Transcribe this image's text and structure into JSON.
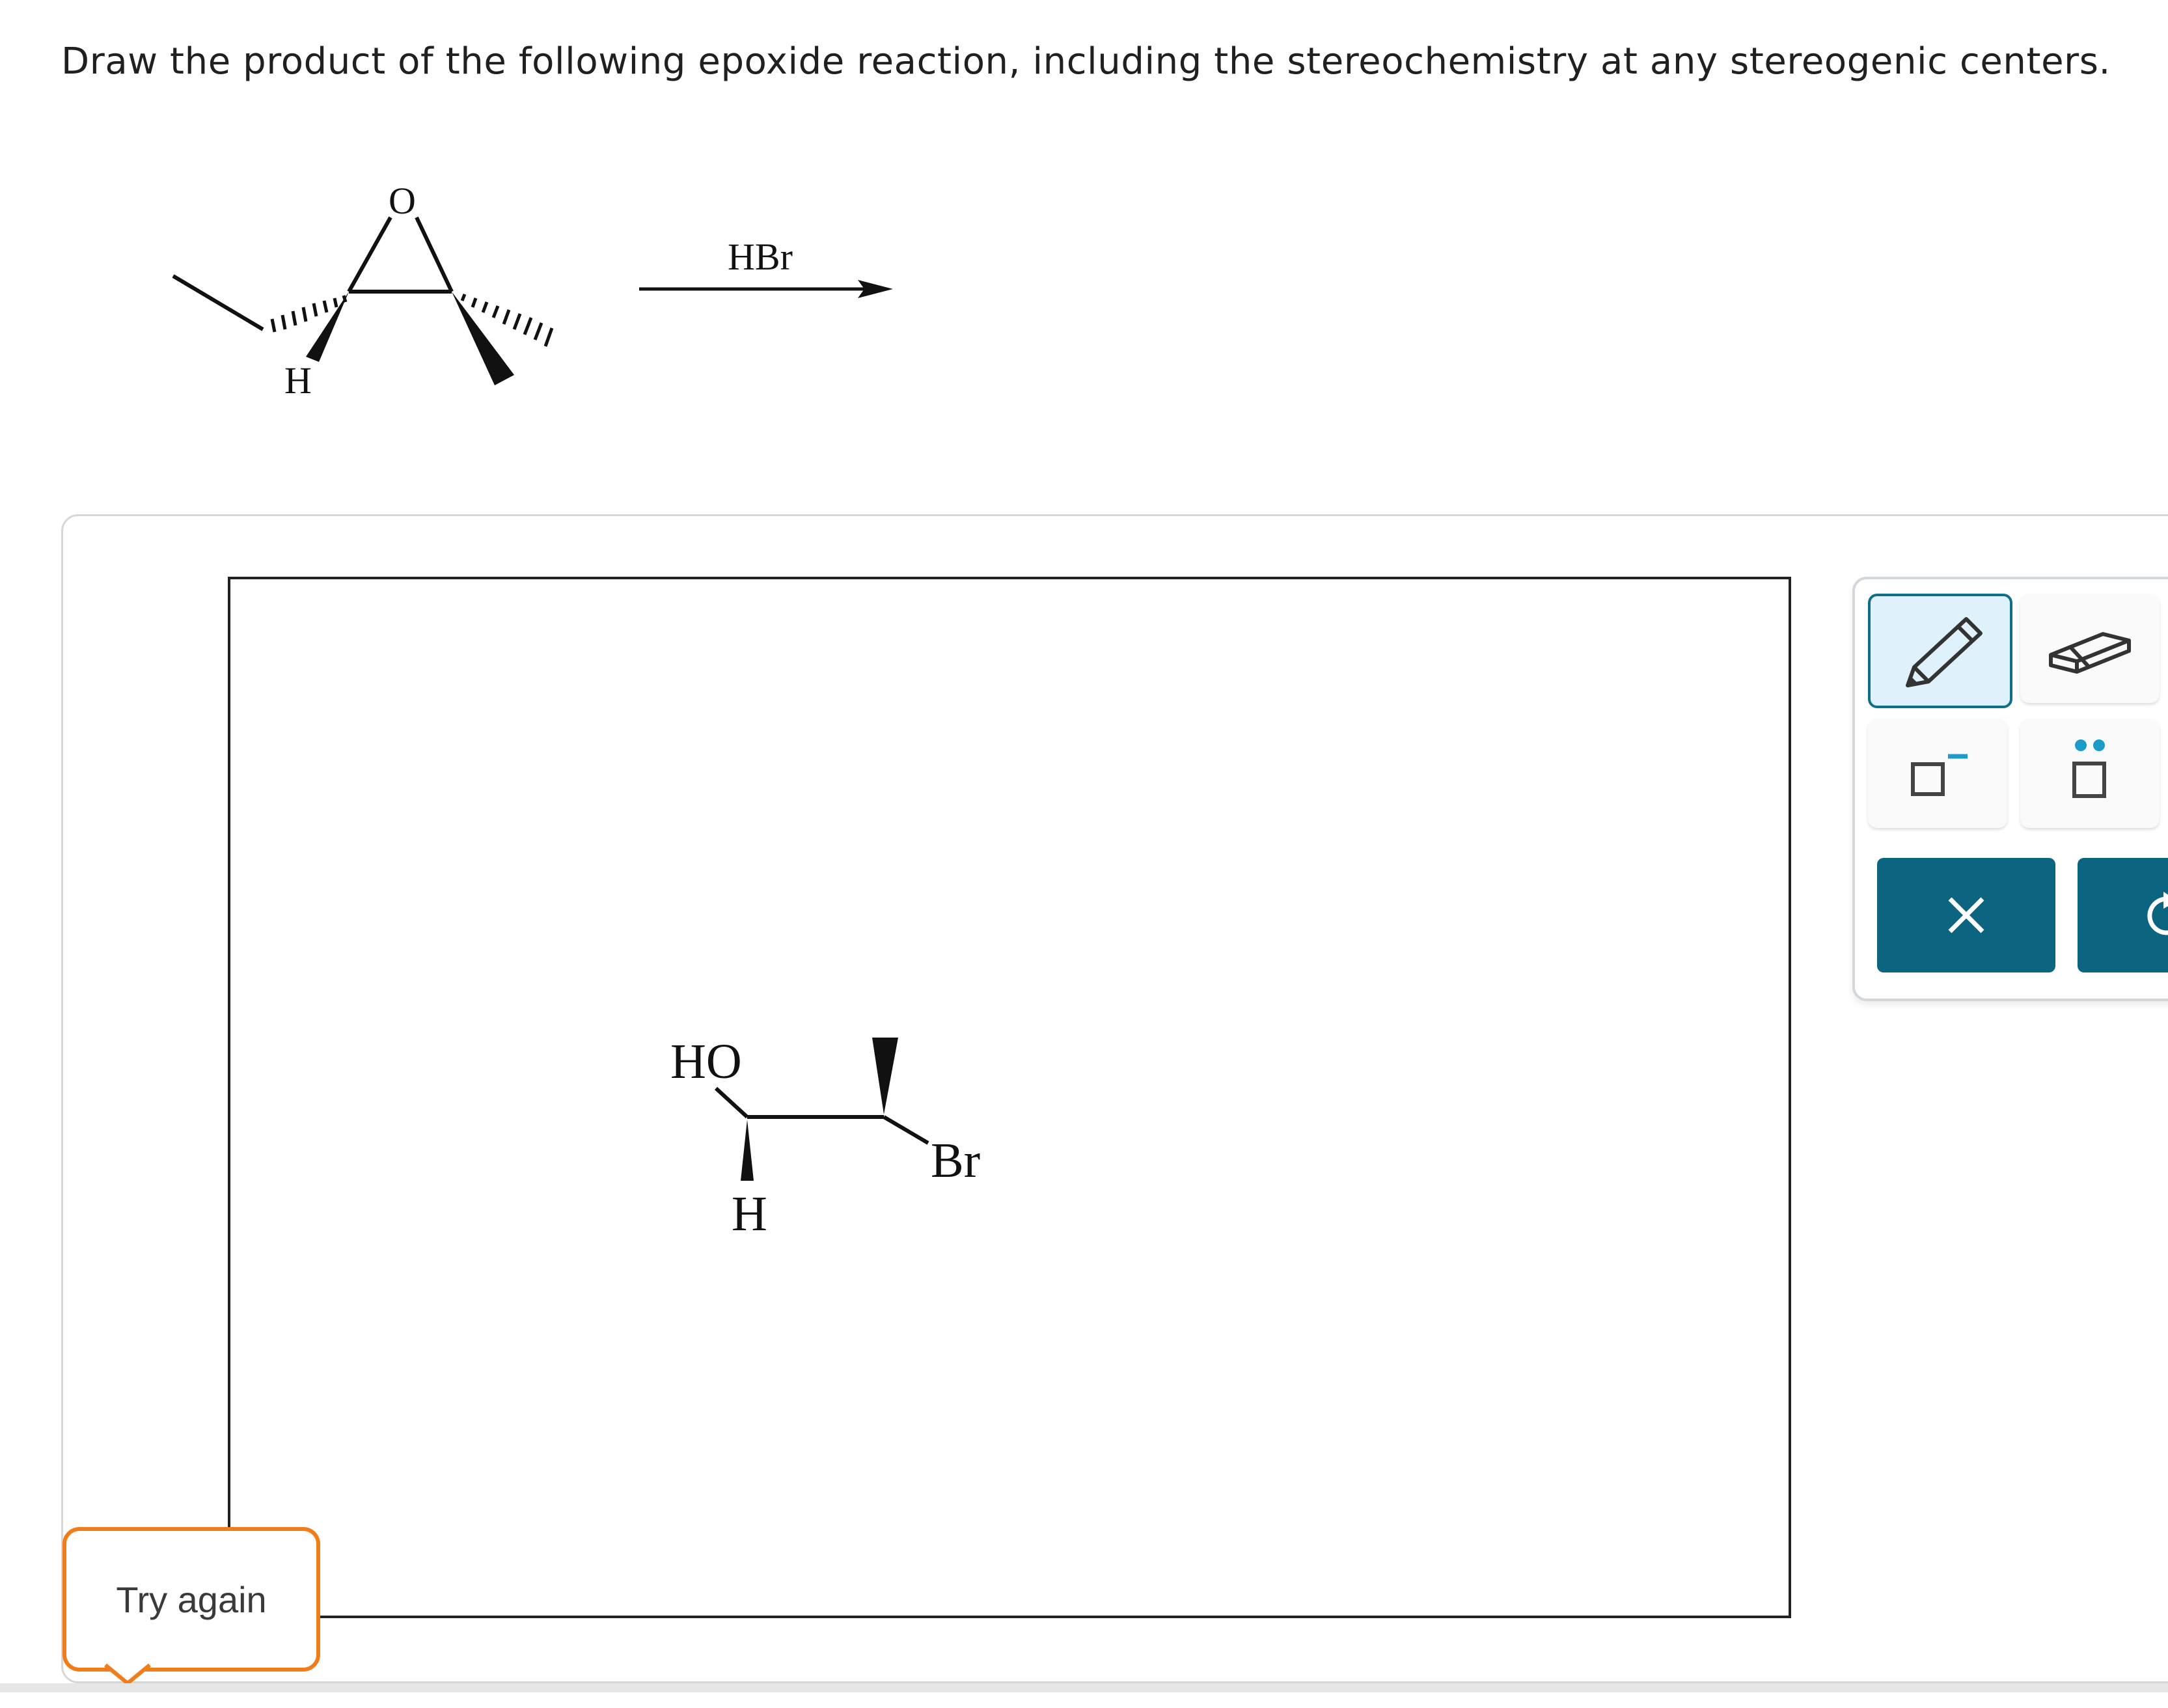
{
  "question": {
    "text": "Draw the product of the following epoxide reaction, including the stereochemistry at any stereogenic centers."
  },
  "reaction": {
    "reactant_oxygen": "O",
    "reactant_h": "H",
    "reagent": "HBr"
  },
  "answer": {
    "ho_label": "HO",
    "h_label": "H",
    "br_label": "Br"
  },
  "toolbar": {
    "tools": [
      "pencil-icon",
      "eraser-icon",
      "charge-icon",
      "lone-pair-icon",
      "clear-icon",
      "undo-icon"
    ]
  },
  "feedback": {
    "try_again": "Try again",
    "color": "#f07d1a"
  },
  "colors": {
    "accent": "#0b6480",
    "active_tool_bg": "#dff1fb"
  }
}
